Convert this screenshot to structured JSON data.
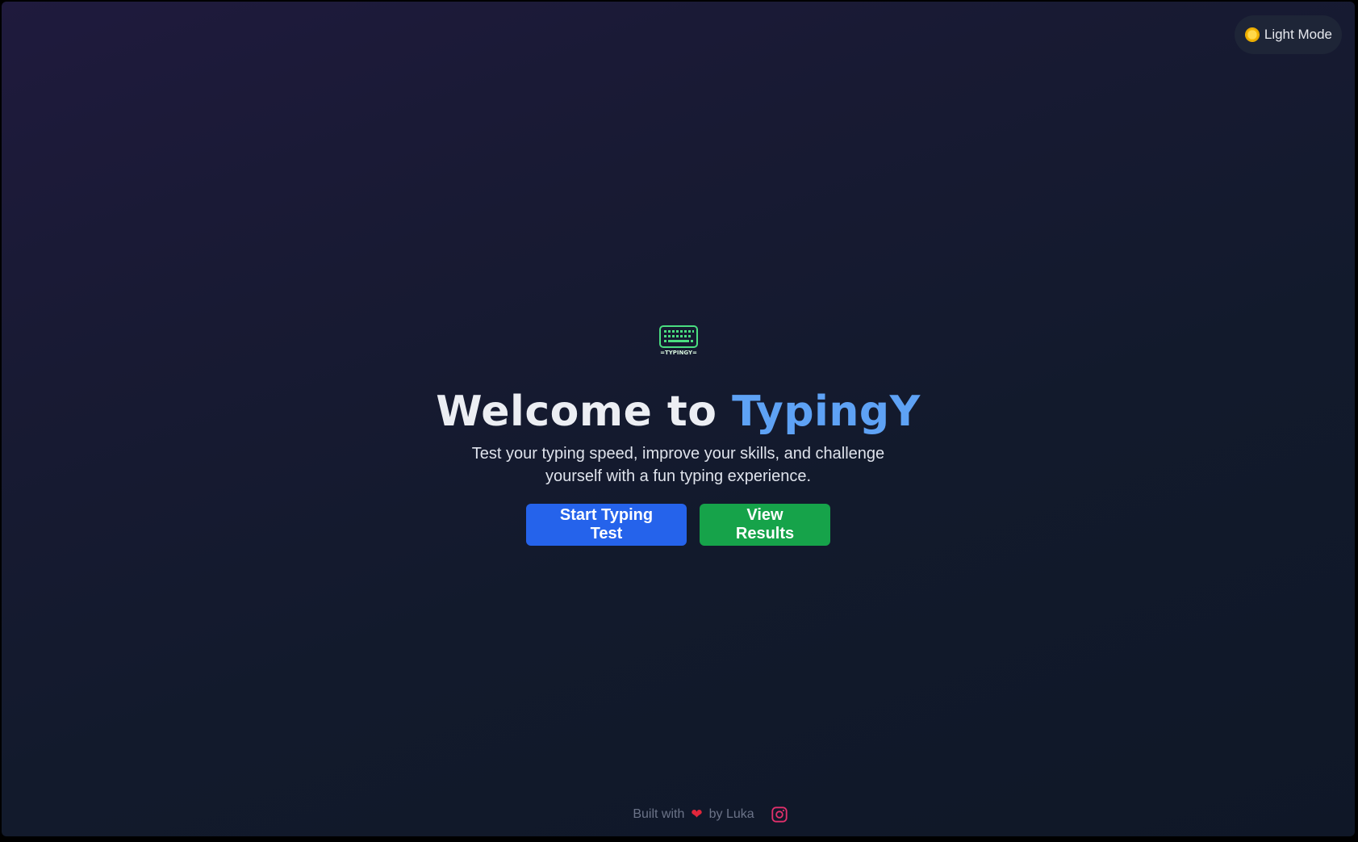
{
  "theme_toggle": {
    "label": "Light Mode",
    "icon": "sun-icon"
  },
  "hero": {
    "logo_text": "=TYPINGY=",
    "title_prefix": "Welcome to ",
    "title_brand": "TypingY",
    "subtitle": "Test your typing speed, improve your skills, and challenge yourself with a fun typing experience."
  },
  "buttons": {
    "start": "Start Typing Test",
    "results": "View Results"
  },
  "footer": {
    "built_with": "Built with",
    "heart": "❤",
    "by": "by Luka",
    "social_icon": "instagram-icon"
  },
  "colors": {
    "brand": "#5ea2f5",
    "primary_button": "#2563eb",
    "secondary_button": "#16a34a",
    "logo_green": "#4ade80",
    "instagram": "#e1306c"
  }
}
